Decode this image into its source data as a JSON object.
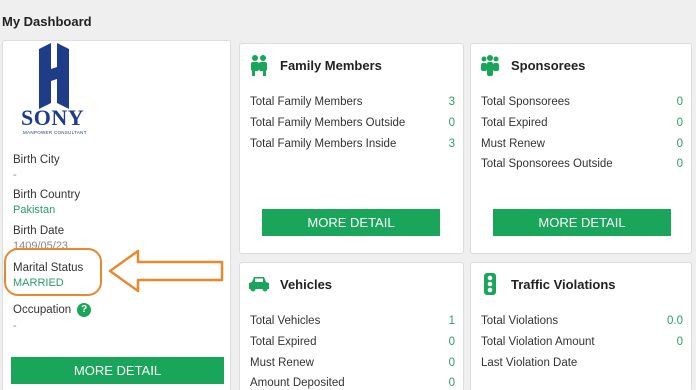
{
  "page": {
    "title": "My Dashboard"
  },
  "profile": {
    "logo_text": "SONY",
    "logo_subtext": "MANPOWER CONSULTANT",
    "fields": [
      {
        "label": "Birth City",
        "value": "-"
      },
      {
        "label": "Birth Country",
        "value": "Pakistan"
      },
      {
        "label": "Birth Date",
        "value": "1409/05/23"
      },
      {
        "label": "Marital Status",
        "value": "MARRIED"
      },
      {
        "label": "Occupation",
        "value": "-"
      }
    ],
    "help_glyph": "?",
    "more_detail": "MORE DETAIL"
  },
  "family": {
    "title": "Family Members",
    "icon": "family-icon",
    "rows": [
      {
        "label": "Total Family Members",
        "value": "3"
      },
      {
        "label": "Total Family Members Outside",
        "value": "0"
      },
      {
        "label": "Total Family Members Inside",
        "value": "3"
      }
    ],
    "more_detail": "MORE DETAIL"
  },
  "sponsorees": {
    "title": "Sponsorees",
    "icon": "people-icon",
    "rows": [
      {
        "label": "Total Sponsorees",
        "value": "0"
      },
      {
        "label": "Total Expired",
        "value": "0"
      },
      {
        "label": "Must Renew",
        "value": "0"
      },
      {
        "label": "Total Sponsorees Outside",
        "value": "0"
      }
    ],
    "more_detail": "MORE DETAIL"
  },
  "vehicles": {
    "title": "Vehicles",
    "icon": "car-icon",
    "rows": [
      {
        "label": "Total Vehicles",
        "value": "1"
      },
      {
        "label": "Total Expired",
        "value": "0"
      },
      {
        "label": "Must Renew",
        "value": "0"
      },
      {
        "label": "Amount Deposited",
        "value": "0"
      }
    ]
  },
  "traffic": {
    "title": "Traffic Violations",
    "icon": "traffic-light-icon",
    "rows": [
      {
        "label": "Total Violations",
        "value": "0.0"
      },
      {
        "label": "Total Violation Amount",
        "value": "0"
      },
      {
        "label": "Last Violation Date",
        "value": ""
      }
    ]
  },
  "colors": {
    "accent": "#19a65b",
    "value": "#2a9d6a",
    "annotation": "#e8892e",
    "brand": "#1f3c88"
  }
}
